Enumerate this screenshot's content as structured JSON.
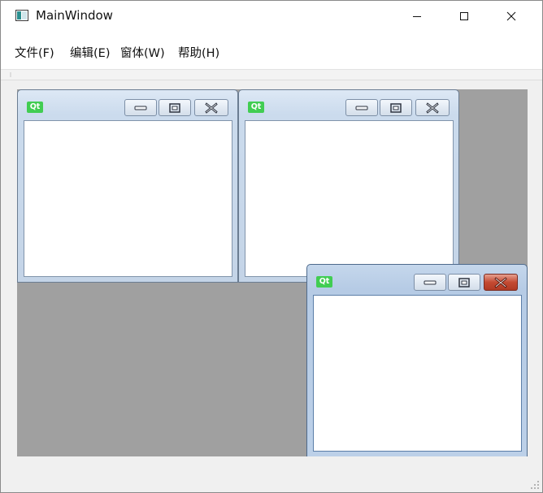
{
  "window": {
    "title": "MainWindow"
  },
  "menu": {
    "items": [
      {
        "label": "文件(F)"
      },
      {
        "label": "编辑(E)"
      },
      {
        "label": "窗体(W)"
      },
      {
        "label": "帮助(H)"
      }
    ]
  },
  "subwindows": [
    {
      "logo_text": "Qt",
      "active": false
    },
    {
      "logo_text": "Qt",
      "active": false
    },
    {
      "logo_text": "Qt",
      "active": true
    }
  ],
  "icons": {
    "app": "app-window-icon",
    "minimize": "minimize-icon",
    "maximize": "maximize-icon",
    "close": "close-icon",
    "qt": "qt-logo-icon"
  },
  "colors": {
    "mdi_background": "#a0a0a0",
    "qt_green": "#41cd52",
    "active_close": "#c44a32"
  }
}
